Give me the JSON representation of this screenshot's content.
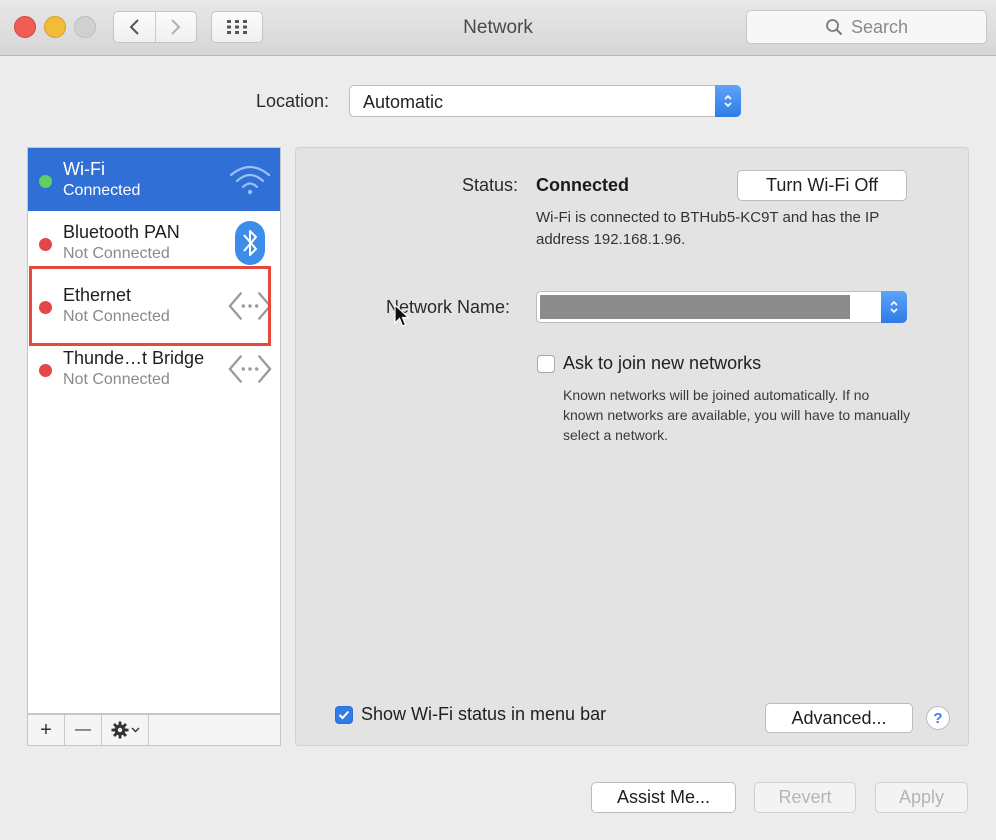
{
  "window": {
    "title": "Network"
  },
  "toolbar": {
    "search_placeholder": "Search",
    "icons": {
      "back": "chevron-left-icon",
      "forward": "chevron-right-icon",
      "grid": "grid-icon",
      "search": "magnifier-icon"
    }
  },
  "location": {
    "label": "Location:",
    "value": "Automatic"
  },
  "services": [
    {
      "name": "Wi-Fi",
      "status": "Connected",
      "state": "connected",
      "icon": "wifi-icon",
      "selected": true
    },
    {
      "name": "Bluetooth PAN",
      "status": "Not Connected",
      "state": "disconnected",
      "icon": "bluetooth-icon"
    },
    {
      "name": "Ethernet",
      "status": "Not Connected",
      "state": "disconnected",
      "icon": "ethernet-icon"
    },
    {
      "name": "Thunde…t Bridge",
      "status": "Not Connected",
      "state": "disconnected",
      "icon": "ethernet-icon"
    }
  ],
  "sidebar_toolbar": {
    "add": "+",
    "remove": "—"
  },
  "detail": {
    "status_label": "Status:",
    "status_value": "Connected",
    "toggle_button": "Turn Wi-Fi Off",
    "status_description": "Wi-Fi is connected to BTHub5-KC9T and has the IP address 192.168.1.96.",
    "network_name_label": "Network Name:",
    "ask_label": "Ask to join new networks",
    "ask_checked": false,
    "ask_description": "Known networks will be joined automatically. If no known networks are available, you will have to manually select a network.",
    "show_status_label": "Show Wi-Fi status in menu bar",
    "show_status_checked": true,
    "advanced_button": "Advanced...",
    "help_button": "?"
  },
  "footer": {
    "assist": "Assist Me...",
    "revert": "Revert",
    "apply": "Apply"
  },
  "colors": {
    "selection": "#2f6fd6",
    "accent": "#2f7be7",
    "connected": "#5fd162",
    "disconnected": "#e44747",
    "highlight": "#e34a3a"
  }
}
